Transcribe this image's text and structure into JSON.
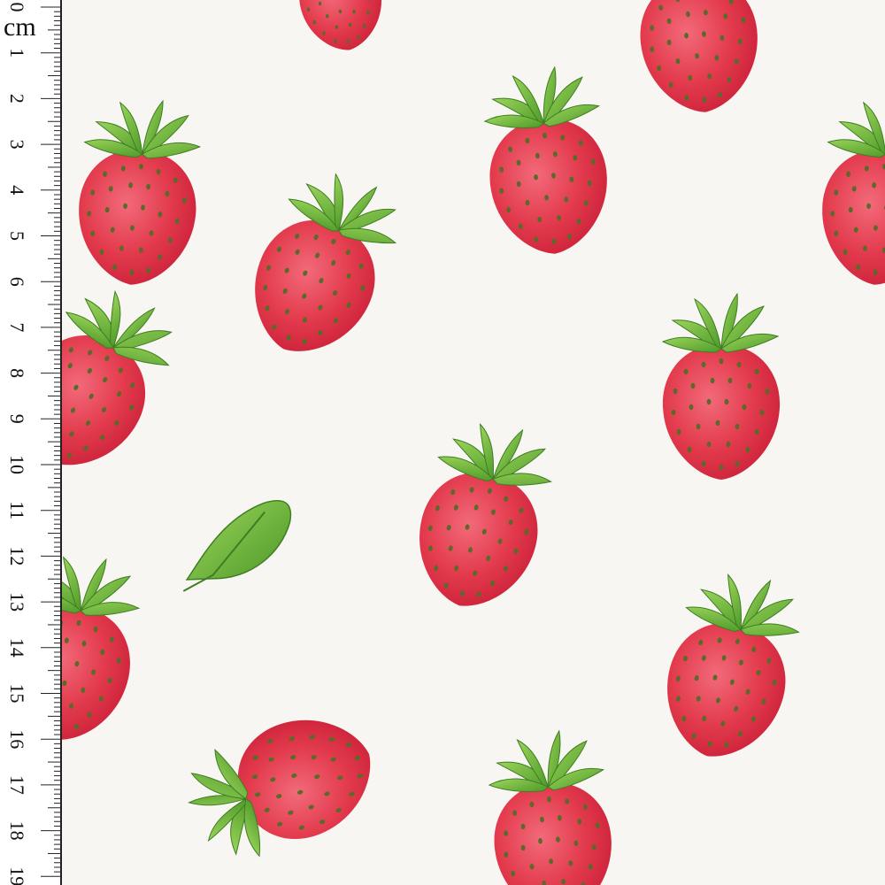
{
  "ruler": {
    "unit": "cm",
    "numbers": [
      "0",
      "1",
      "2",
      "3",
      "4",
      "5",
      "6",
      "7",
      "8",
      "9",
      "10",
      "11",
      "12",
      "13",
      "14",
      "15",
      "16",
      "17",
      "18",
      "19"
    ]
  },
  "pattern": {
    "background_color": "#f8f6f2",
    "berry_color": "#e23a4c",
    "berry_dark": "#c81e38",
    "leaf_color": "#6fb83a",
    "seed_color": "#5a6a2a",
    "motifs": [
      "strawberry",
      "strawberry-leaf"
    ]
  }
}
